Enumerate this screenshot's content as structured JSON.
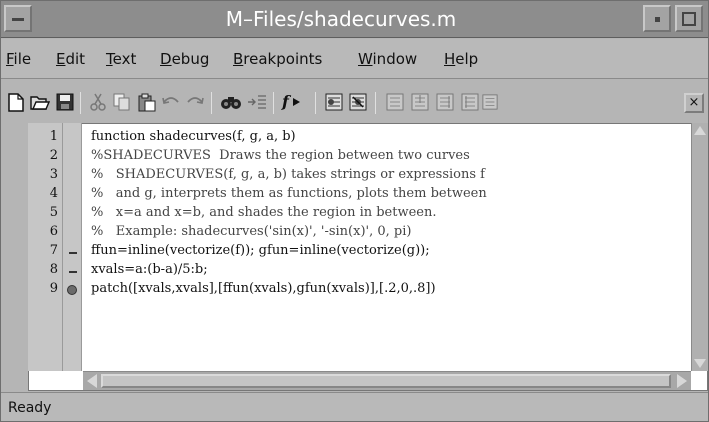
{
  "window": {
    "title": "M–Files/shadecurves.m"
  },
  "menu": [
    {
      "label": "File",
      "mnemonic": "F",
      "rest": "ile"
    },
    {
      "label": "Edit",
      "mnemonic": "E",
      "rest": "dit"
    },
    {
      "label": "Text",
      "mnemonic": "T",
      "rest": "ext"
    },
    {
      "label": "Debug",
      "mnemonic": "D",
      "rest": "ebug"
    },
    {
      "label": "Breakpoints",
      "mnemonic": "B",
      "rest": "reakpoints"
    },
    {
      "label": "Window",
      "mnemonic": "W",
      "rest": "indow"
    },
    {
      "label": "Help",
      "mnemonic": "H",
      "rest": "elp"
    }
  ],
  "toolbar": {
    "icons": [
      "new-file-icon",
      "open-file-icon",
      "save-icon",
      "cut-icon",
      "copy-icon",
      "paste-icon",
      "undo-icon",
      "redo-icon",
      "find-icon",
      "goto-line-icon",
      "function-icon",
      "set-breakpoint-icon",
      "clear-breakpoints-icon",
      "step-icon",
      "step-in-icon",
      "step-out-icon",
      "continue-icon",
      "quit-debug-icon"
    ],
    "close_label": "×"
  },
  "editor": {
    "lines": [
      {
        "num": "1",
        "marker": "",
        "text": "function shadecurves(f, g, a, b)",
        "comment": false
      },
      {
        "num": "2",
        "marker": "",
        "text": "%SHADECURVES  Draws the region between two curves",
        "comment": true
      },
      {
        "num": "3",
        "marker": "",
        "text": "%   SHADECURVES(f, g, a, b) takes strings or expressions f",
        "comment": true
      },
      {
        "num": "4",
        "marker": "",
        "text": "%   and g, interprets them as functions, plots them between",
        "comment": true
      },
      {
        "num": "5",
        "marker": "",
        "text": "%   x=a and x=b, and shades the region in between.",
        "comment": true
      },
      {
        "num": "6",
        "marker": "",
        "text": "%   Example: shadecurves('sin(x)', '-sin(x)', 0, pi)",
        "comment": true
      },
      {
        "num": "7",
        "marker": "dash",
        "text": "ffun=inline(vectorize(f)); gfun=inline(vectorize(g));",
        "comment": false
      },
      {
        "num": "8",
        "marker": "dash",
        "text": "xvals=a:(b-a)/5:b;",
        "comment": false
      },
      {
        "num": "9",
        "marker": "dot",
        "text": "patch([xvals,xvals],[ffun(xvals),gfun(xvals)],[.2,0,.8])",
        "comment": false
      }
    ]
  },
  "status": {
    "text": "Ready"
  }
}
